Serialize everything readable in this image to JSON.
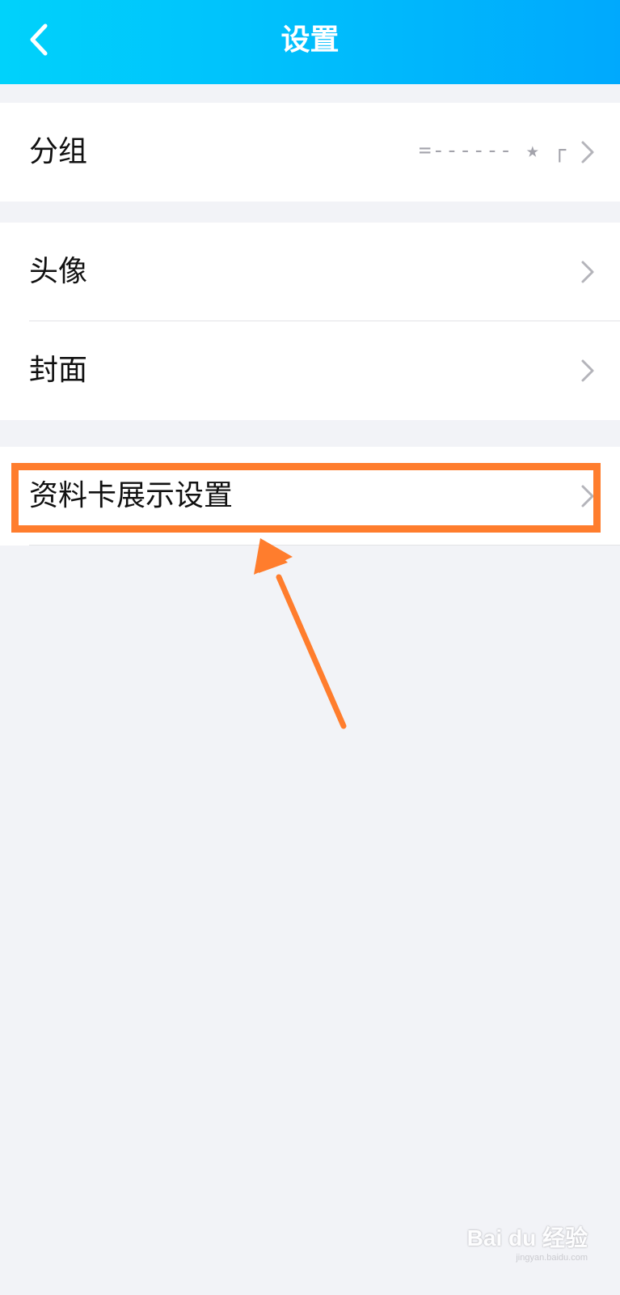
{
  "header": {
    "title": "设置",
    "back_icon": "chevron-left-icon",
    "background_start": "#00d2fb",
    "background_end": "#00a9fd"
  },
  "groups": [
    {
      "items": [
        {
          "label": "分组",
          "value": "=------ ★ ┌",
          "icon": "chevron-right-icon"
        }
      ]
    },
    {
      "items": [
        {
          "label": "头像",
          "icon": "chevron-right-icon"
        },
        {
          "label": "封面",
          "icon": "chevron-right-icon"
        }
      ]
    },
    {
      "items": [
        {
          "label": "资料卡展示设置",
          "icon": "chevron-right-icon",
          "highlighted": true
        }
      ]
    }
  ],
  "annotation": {
    "highlight_color": "#ff7d2d",
    "arrow_color": "#ff7d2d",
    "arrow_icon": "arrow-up-icon"
  },
  "watermark": {
    "text": "Bai du 经验",
    "sub": "jingyan.baidu.com"
  }
}
